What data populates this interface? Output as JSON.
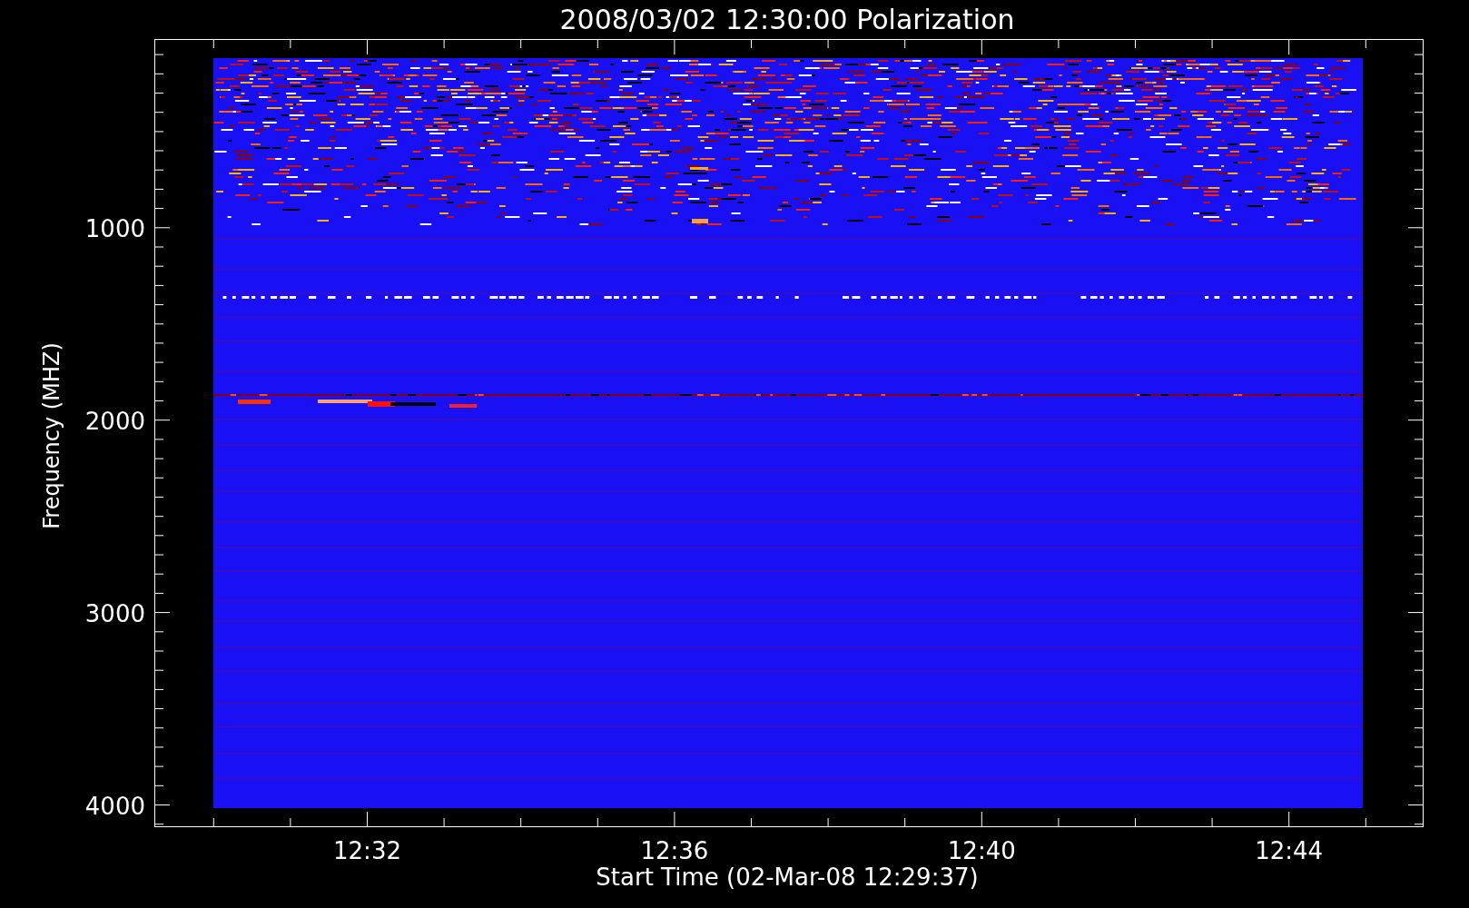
{
  "title": "2008/03/02 12:30:00 Polarization",
  "y_axis": {
    "label": "Frequency (MHZ)",
    "ticks": [
      "1000",
      "2000",
      "3000",
      "4000"
    ]
  },
  "x_axis": {
    "label": "Start Time (02-Mar-08 12:29:37)",
    "ticks": [
      "12:32",
      "12:36",
      "12:40",
      "12:44"
    ]
  }
}
